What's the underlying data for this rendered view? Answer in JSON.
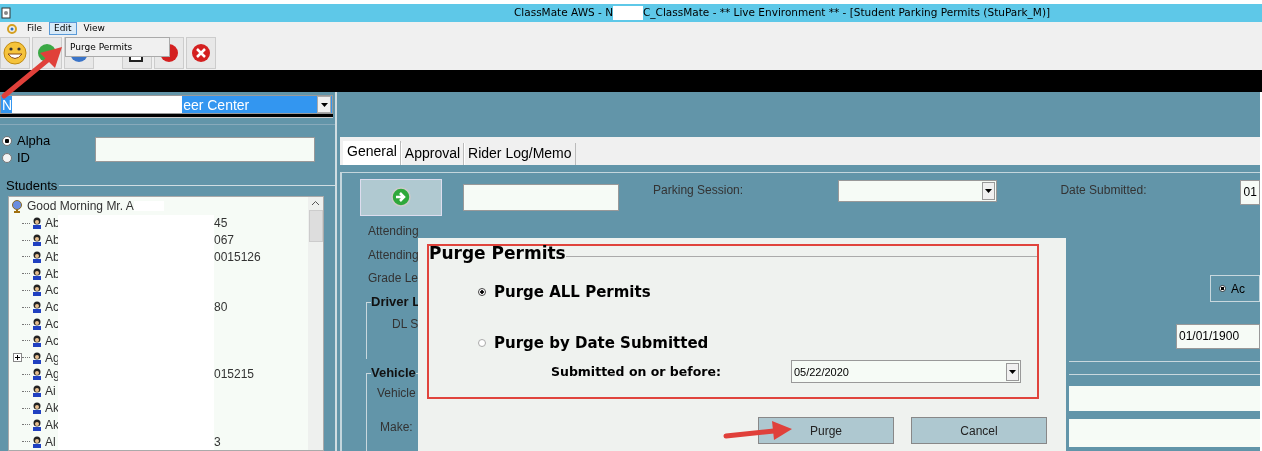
{
  "window": {
    "title_start": "ClassMate AWS - N",
    "title_end": "C_ClassMate - ** Live Environment ** - [Student Parking Permits (StuPark_M)]"
  },
  "menu": [
    {
      "label": "File",
      "selected": false
    },
    {
      "label": "Edit",
      "selected": true
    },
    {
      "label": "View",
      "selected": false
    }
  ],
  "menu_popup": {
    "items": [
      "Purge Permits"
    ]
  },
  "location_combo": {
    "value_start": "N",
    "value_end": "eer Center"
  },
  "search_modes": [
    {
      "label": "Alpha",
      "selected": true
    },
    {
      "label": "ID",
      "selected": false
    }
  ],
  "students": {
    "title": "Students",
    "root": "Good Morning Mr. A",
    "children": [
      {
        "start": "Ab",
        "end": "45",
        "kind": "leaf"
      },
      {
        "start": "Ab",
        "end": "067",
        "kind": "leaf"
      },
      {
        "start": "Ab",
        "end": "0015126",
        "kind": "leaf"
      },
      {
        "start": "Ab",
        "kind": "leaf"
      },
      {
        "start": "Ac",
        "kind": "leaf"
      },
      {
        "start": "Ac",
        "end": "80",
        "kind": "leaf"
      },
      {
        "start": "Ac",
        "kind": "leaf"
      },
      {
        "start": "Ac",
        "kind": "leaf"
      },
      {
        "start": "Ag",
        "kind": "collapsed"
      },
      {
        "start": "Ag",
        "end": "015215",
        "kind": "leaf"
      },
      {
        "start": "Ai",
        "kind": "leaf"
      },
      {
        "start": "Ak",
        "kind": "leaf"
      },
      {
        "start": "Ak",
        "kind": "leaf"
      },
      {
        "start": "Al",
        "end": "3",
        "kind": "leaf"
      }
    ]
  },
  "tabs": [
    {
      "label": "General",
      "selected": true
    },
    {
      "label": "Approval",
      "selected": false
    },
    {
      "label": "Rider Log/Memo",
      "selected": false
    }
  ],
  "form": {
    "parking_session_label": "Parking Session:",
    "date_submitted_label": "Date Submitted:",
    "date_submitted_value": "01",
    "left_labels": [
      "Attending",
      "Attending",
      "Grade Le"
    ],
    "driver_group": "Driver L",
    "driver_label": "DL S",
    "vehicle_group": "Vehicle",
    "vehicle_label": "Vehicle",
    "make_label": "Make:",
    "status_option": {
      "label": "Ac",
      "selected": true
    },
    "date_value": "01/01/1900"
  },
  "dialog": {
    "title": "Purge Permits",
    "options": [
      {
        "label": "Purge ALL Permits",
        "selected": true
      },
      {
        "label": "Purge by Date Submitted",
        "selected": false
      }
    ],
    "date_label": "Submitted on or before:",
    "date_value": "05/22/2020",
    "buttons": [
      "Purge",
      "Cancel"
    ]
  }
}
